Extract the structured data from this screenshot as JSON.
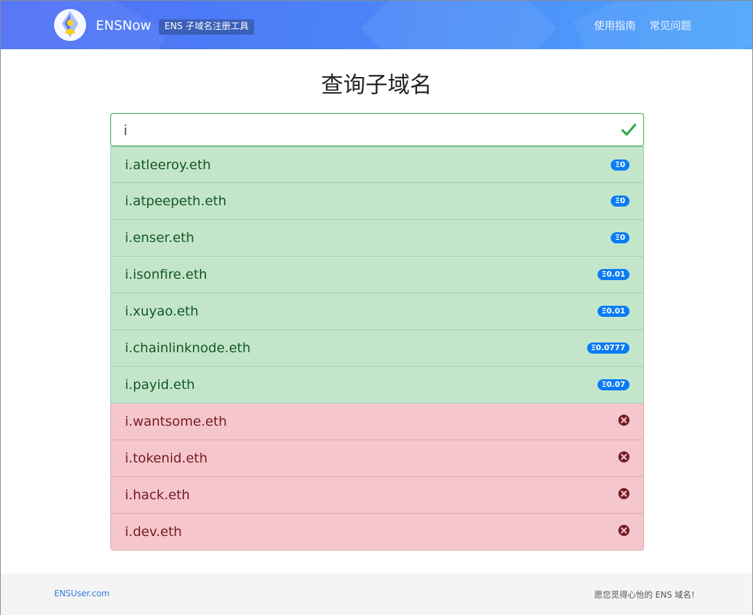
{
  "header": {
    "brand": "ENSNow",
    "tag": "ENS 子域名注册工具",
    "nav": [
      "使用指南",
      "常见问题"
    ]
  },
  "main": {
    "title": "查询子域名",
    "search": {
      "value": "i",
      "status": "valid"
    }
  },
  "results": [
    {
      "name": "i.atleeroy.eth",
      "status": "available",
      "price": "Ξ0"
    },
    {
      "name": "i.atpeepeth.eth",
      "status": "available",
      "price": "Ξ0"
    },
    {
      "name": "i.enser.eth",
      "status": "available",
      "price": "Ξ0"
    },
    {
      "name": "i.isonfire.eth",
      "status": "available",
      "price": "Ξ0.01"
    },
    {
      "name": "i.xuyao.eth",
      "status": "available",
      "price": "Ξ0.01"
    },
    {
      "name": "i.chainlinknode.eth",
      "status": "available",
      "price": "Ξ0.0777"
    },
    {
      "name": "i.payid.eth",
      "status": "available",
      "price": "Ξ0.07"
    },
    {
      "name": "i.wantsome.eth",
      "status": "unavailable"
    },
    {
      "name": "i.tokenid.eth",
      "status": "unavailable"
    },
    {
      "name": "i.hack.eth",
      "status": "unavailable"
    },
    {
      "name": "i.dev.eth",
      "status": "unavailable"
    }
  ],
  "footer": {
    "left": "ENSUser.com",
    "right": "愿您觅得心怡的 ENS 域名!"
  },
  "colors": {
    "header_start": "#4f6ff5",
    "header_end": "#4ea6fb",
    "available_bg": "#c3e6cb",
    "unavailable_bg": "#f5c6cb",
    "badge": "#0a7bf5",
    "valid": "#28a745"
  }
}
